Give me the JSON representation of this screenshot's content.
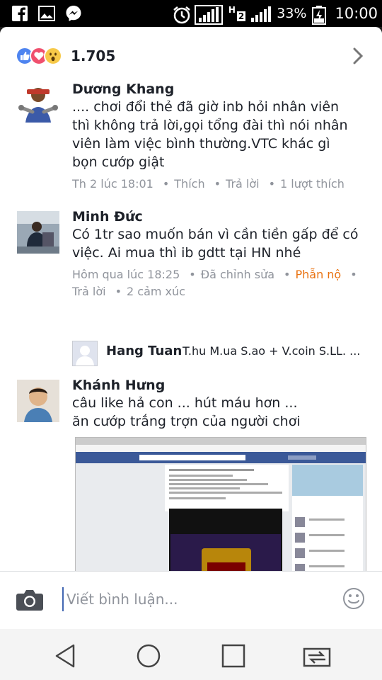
{
  "status_bar": {
    "battery": "33%",
    "time": "10:00",
    "network_label": "H",
    "sim_label": "2"
  },
  "reactions": {
    "count": "1.705",
    "icons": [
      "like-icon",
      "love-icon",
      "wow-icon"
    ]
  },
  "comments": [
    {
      "name": "Dương Khang",
      "text_lines": [
        ".... chơi đổi thẻ đã giờ inb hỏi nhân viên",
        "thì không trả lời,gọi tổng đài thì nói nhân",
        "viên làm việc bình thường.VTC khác gì",
        "bọn cướp giật"
      ],
      "time": "Th 2 lúc 18:01",
      "like": "Thích",
      "reply": "Trả lời",
      "likes": "1 lượt thích"
    },
    {
      "name": "Minh Đức",
      "text_lines": [
        "Có 1tr sao muốn bán vì cần tiền gấp để có",
        "việc. Ai mua thì ib gdtt tại HN nhé"
      ],
      "time": "Hôm qua lúc 18:25",
      "edited": "Đã chỉnh sửa",
      "react_label": "Phẫn nộ",
      "reply": "Trả lời",
      "reactions": "2 cảm xúc"
    },
    {
      "name": "Khánh Hưng",
      "text_lines": [
        "câu like hả con ... hút máu hơn ...",
        "ăn cướp trắng trợn của người chơi"
      ]
    }
  ],
  "reply_preview": {
    "name": "Hang Tuan",
    "text": "T.hu M.ua S.ao + V.coin S.LL. ..."
  },
  "composer": {
    "placeholder": "Viết bình luận..."
  },
  "colors": {
    "accent": "#4267b2",
    "reaction_orange": "#e9710f",
    "meta_gray": "#90949c"
  }
}
